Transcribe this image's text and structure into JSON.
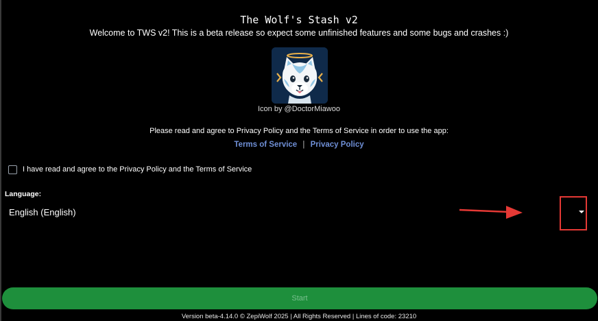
{
  "app": {
    "title": "The Wolf's Stash v2",
    "welcome": "Welcome to TWS v2! This is a beta release so expect some unfinished features and some bugs and crashes :)",
    "icon_credit": "Icon by @DoctorMiawoo"
  },
  "agreement": {
    "prompt": "Please read and agree to Privacy Policy and the Terms of Service in order to use the app:",
    "terms_link": "Terms of Service",
    "separator": "|",
    "privacy_link": "Privacy Policy",
    "checkbox_label": "I have read and agree to the Privacy Policy and the Terms of Service",
    "checked": false
  },
  "language": {
    "label": "Language:",
    "selected": "English (English)"
  },
  "start_button": {
    "label": "Start",
    "enabled": false
  },
  "footer": {
    "text": "Version beta-4.14.0 © ZepiWolf 2025 | All Rights Reserved | Lines of code: 23210"
  },
  "annotation": {
    "color": "#e53935",
    "target": "language-dropdown-caret"
  },
  "colors": {
    "background": "#000000",
    "link": "#6f8fd6",
    "start_button": "#1e8f3c",
    "icon_background": "#0f2a4a"
  }
}
